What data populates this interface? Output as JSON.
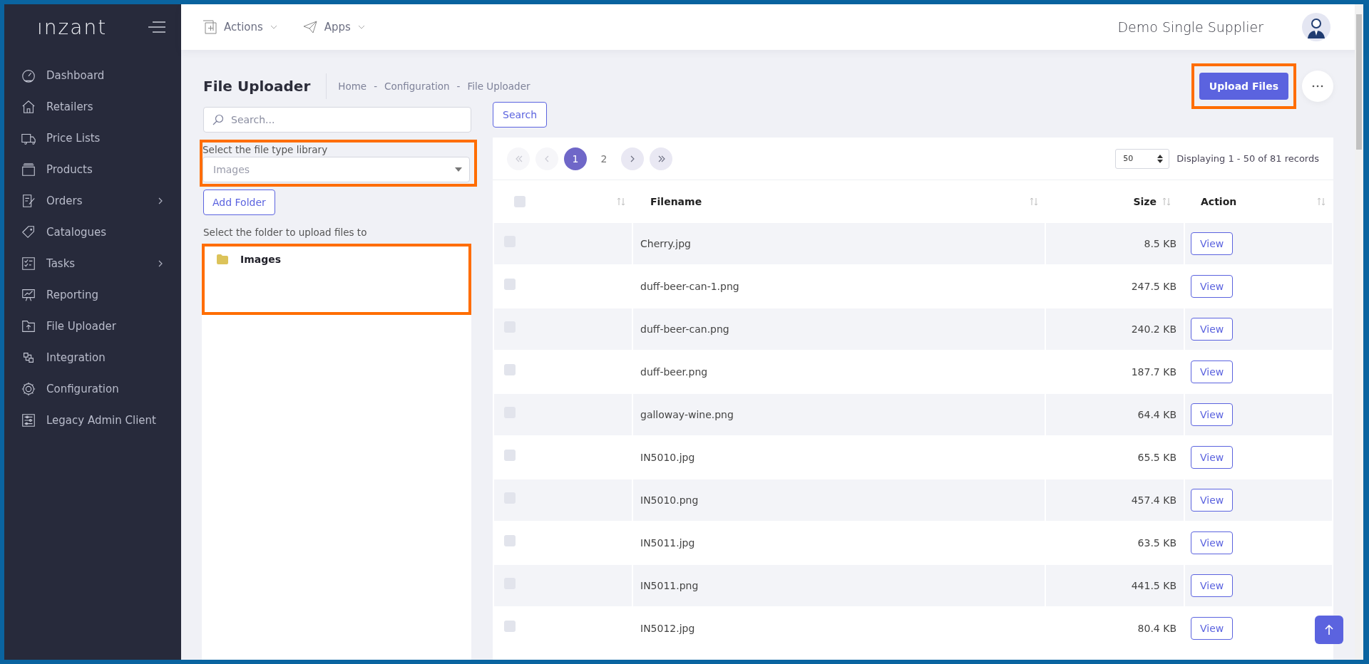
{
  "sidebar": {
    "logo": "ınzant",
    "items": [
      {
        "label": "Dashboard",
        "has_submenu": false
      },
      {
        "label": "Retailers",
        "has_submenu": false
      },
      {
        "label": "Price Lists",
        "has_submenu": false
      },
      {
        "label": "Products",
        "has_submenu": false
      },
      {
        "label": "Orders",
        "has_submenu": true
      },
      {
        "label": "Catalogues",
        "has_submenu": false
      },
      {
        "label": "Tasks",
        "has_submenu": true
      },
      {
        "label": "Reporting",
        "has_submenu": false
      },
      {
        "label": "File Uploader",
        "has_submenu": false
      },
      {
        "label": "Integration",
        "has_submenu": false
      },
      {
        "label": "Configuration",
        "has_submenu": false
      },
      {
        "label": "Legacy Admin Client",
        "has_submenu": false
      }
    ]
  },
  "header": {
    "menus": [
      "Actions",
      "Apps"
    ],
    "company": "Demo Single Supplier"
  },
  "page": {
    "title": "File Uploader",
    "breadcrumb": [
      "Home",
      "Configuration",
      "File Uploader"
    ],
    "breadcrumb_separator": "-",
    "upload_button": "Upload Files",
    "highlighted": true
  },
  "search": {
    "placeholder": "Search...",
    "button": "Search"
  },
  "library": {
    "label": "Select the file type library",
    "value": "Images",
    "highlighted": true
  },
  "add_folder": "Add Folder",
  "folders": {
    "label": "Select the folder to upload files to",
    "items": [
      {
        "name": "Images"
      }
    ],
    "highlighted": true
  },
  "pagination": {
    "nav": [
      {
        "kind": "first",
        "disabled": true
      },
      {
        "kind": "prev",
        "disabled": true
      },
      {
        "kind": "next",
        "disabled": false
      },
      {
        "kind": "last",
        "disabled": false
      }
    ],
    "pages": [
      {
        "label": "1",
        "selected": true
      },
      {
        "label": "2",
        "selected": false
      }
    ],
    "page_size": "50",
    "summary": "Displaying 1 - 50 of 81 records"
  },
  "table": {
    "header_checked": false,
    "columns": [
      "Filename",
      "Size",
      "Action"
    ],
    "rows": [
      {
        "filename": "Cherry.jpg",
        "size": "8.5 KB",
        "action": "View",
        "checked": false
      },
      {
        "filename": "duff-beer-can-1.png",
        "size": "247.5 KB",
        "action": "View",
        "checked": false
      },
      {
        "filename": "duff-beer-can.png",
        "size": "240.2 KB",
        "action": "View",
        "checked": false
      },
      {
        "filename": "duff-beer.png",
        "size": "187.7 KB",
        "action": "View",
        "checked": false
      },
      {
        "filename": "galloway-wine.png",
        "size": "64.4 KB",
        "action": "View",
        "checked": false
      },
      {
        "filename": "IN5010.jpg",
        "size": "65.5 KB",
        "action": "View",
        "checked": false
      },
      {
        "filename": "IN5010.png",
        "size": "457.4 KB",
        "action": "View",
        "checked": false
      },
      {
        "filename": "IN5011.jpg",
        "size": "63.5 KB",
        "action": "View",
        "checked": false
      },
      {
        "filename": "IN5011.png",
        "size": "441.5 KB",
        "action": "View",
        "checked": false
      },
      {
        "filename": "IN5012.jpg",
        "size": "80.4 KB",
        "action": "View",
        "checked": false
      }
    ]
  }
}
